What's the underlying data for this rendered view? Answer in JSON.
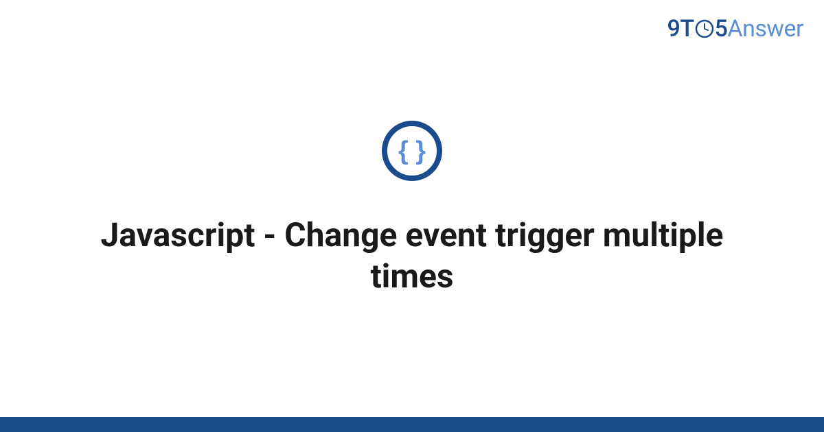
{
  "logo": {
    "part1": "9T",
    "part2": "5",
    "part3": "Answer"
  },
  "main": {
    "title": "Javascript - Change event trigger multiple times",
    "category_icon": "code-braces-icon"
  },
  "colors": {
    "brand_dark": "#1a4b8c",
    "brand_light": "#5a8fd4",
    "icon_ring": "#1a4b8c",
    "icon_braces": "#5a8fd4",
    "text": "#1a1a1a"
  }
}
